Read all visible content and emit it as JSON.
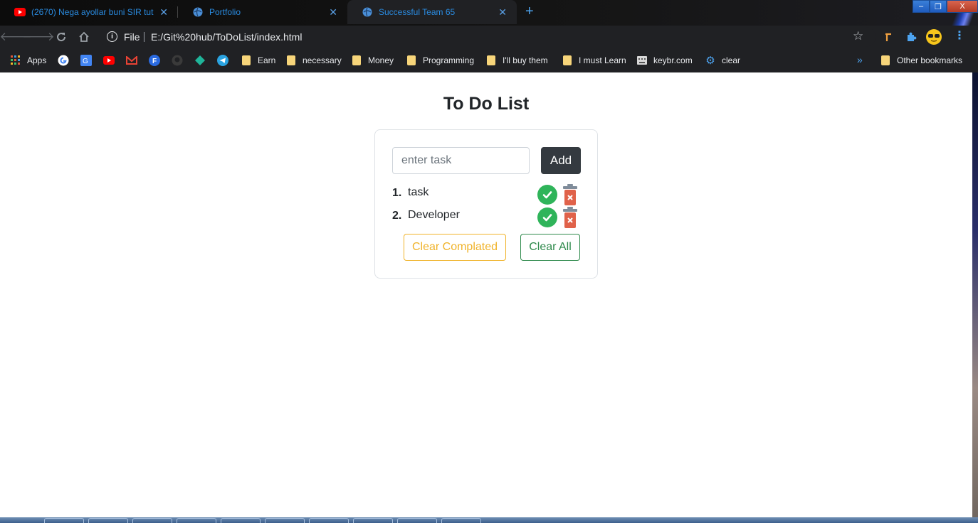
{
  "browser": {
    "tabs": [
      {
        "title": "(2670) Nega ayollar buni SIR tuti",
        "icon": "youtube-icon",
        "active": false
      },
      {
        "title": "Portfolio",
        "icon": "globe-icon",
        "active": false
      },
      {
        "title": "Successful Team 65",
        "icon": "globe-icon",
        "active": true
      }
    ],
    "new_tab": "+",
    "window_controls": {
      "minimize": "–",
      "maximize": "❐",
      "close": "X"
    },
    "address": {
      "info": "i",
      "scheme_label": "File",
      "url": "E:/Git%20hub/ToDoList/index.html"
    },
    "bookmarks": [
      {
        "label": "Apps",
        "icon": "apps-grid-icon"
      },
      {
        "label": "",
        "icon": "google-icon"
      },
      {
        "label": "",
        "icon": "google-translate-icon"
      },
      {
        "label": "",
        "icon": "youtube-icon"
      },
      {
        "label": "",
        "icon": "gmail-icon"
      },
      {
        "label": "",
        "icon": "f-icon"
      },
      {
        "label": "",
        "icon": "github-icon"
      },
      {
        "label": "",
        "icon": "diamond-icon"
      },
      {
        "label": "",
        "icon": "telegram-icon"
      },
      {
        "label": "Earn",
        "icon": "folder-icon"
      },
      {
        "label": "necessary",
        "icon": "folder-icon"
      },
      {
        "label": "Money",
        "icon": "folder-icon"
      },
      {
        "label": "Programming",
        "icon": "folder-icon"
      },
      {
        "label": "I'll buy them",
        "icon": "folder-icon"
      },
      {
        "label": "I must Learn",
        "icon": "folder-icon"
      },
      {
        "label": "keybr.com",
        "icon": "keyboard-icon"
      },
      {
        "label": "clear",
        "icon": "gear-icon"
      }
    ],
    "more_bookmarks": "»",
    "other_bookmarks": "Other bookmarks"
  },
  "app": {
    "title": "To Do List",
    "input_placeholder": "enter task",
    "input_value": "",
    "add_label": "Add",
    "tasks": [
      {
        "num": "1.",
        "text": "task"
      },
      {
        "num": "2.",
        "text": "Developer"
      }
    ],
    "clear_completed_label": "Clear Complated",
    "clear_all_label": "Clear All"
  },
  "colors": {
    "add_button": "#343a40",
    "check": "#2fb45a",
    "trash": "#e0624a",
    "clear_completed": "#f0b32a",
    "clear_all": "#2f8a4c",
    "tab_text": "#2a8be0"
  }
}
